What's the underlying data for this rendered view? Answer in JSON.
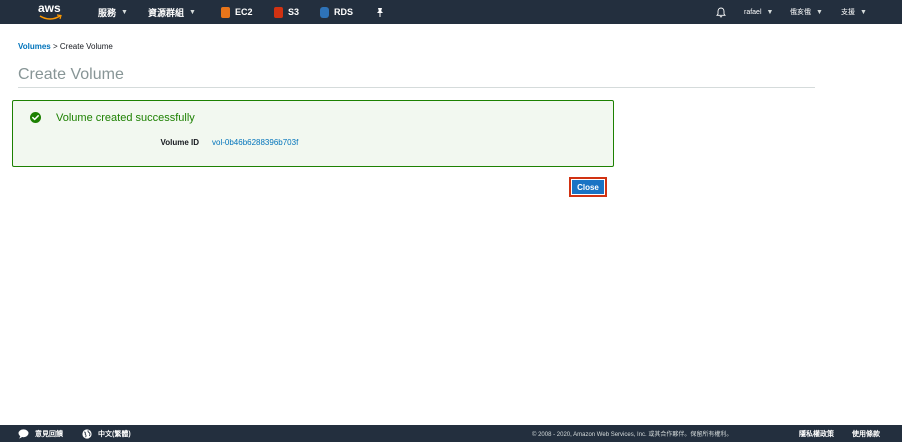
{
  "topnav": {
    "logo": "aws",
    "services_label": "服務",
    "resource_groups_label": "資源群組",
    "shortcuts": [
      {
        "label": "EC2",
        "color": "#e8751a"
      },
      {
        "label": "S3",
        "color": "#d13212"
      },
      {
        "label": "RDS",
        "color": "#2e73b8"
      }
    ],
    "user": "rafael",
    "region": "俄亥俄",
    "support": "支援"
  },
  "breadcrumb": {
    "parent": "Volumes",
    "separator": ">",
    "current": "Create Volume"
  },
  "page_title": "Create Volume",
  "alert": {
    "message": "Volume created successfully",
    "field_label": "Volume ID",
    "field_value": "vol-0b46b6288396b703f",
    "status_color": "#1d8102"
  },
  "close_button": {
    "label": "Close"
  },
  "footer": {
    "feedback": "意見回饋",
    "language": "中文(繁體)",
    "copyright": "© 2008 - 2020, Amazon Web Services, Inc. 或其合作夥伴。保留所有權利。",
    "privacy": "隱私權政策",
    "terms": "使用條款"
  },
  "colors": {
    "nav_bg": "#232f3e",
    "link": "#0073bb",
    "primary_button": "#1a73c4",
    "highlight_border": "#d13212"
  },
  "icons": [
    "aws-logo-icon",
    "chevron-down-icon",
    "ec2-icon",
    "s3-icon",
    "rds-icon",
    "pin-icon",
    "bell-icon",
    "check-circle-icon",
    "speech-bubble-icon",
    "globe-icon"
  ]
}
